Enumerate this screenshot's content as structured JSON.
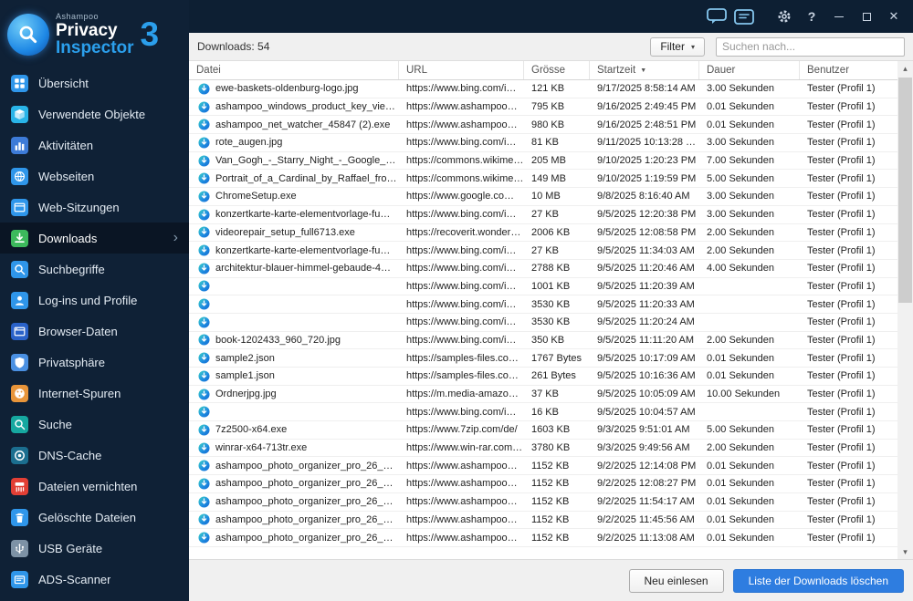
{
  "logo": {
    "brand": "Ashampoo",
    "line1": "Privacy",
    "line2": "Inspector",
    "version": "3"
  },
  "titlebar": {
    "help_label": "?"
  },
  "toolbar": {
    "count_label": "Downloads: 54",
    "filter_label": "Filter",
    "search_placeholder": "Suchen nach..."
  },
  "sidebar": {
    "items": [
      {
        "id": "uebersicht",
        "label": "Übersicht",
        "icon": "dashboard",
        "color": "#2f96ea"
      },
      {
        "id": "verwendete-objekte",
        "label": "Verwendete Objekte",
        "icon": "cube",
        "color": "#29b4e8"
      },
      {
        "id": "aktivitaeten",
        "label": "Aktivitäten",
        "icon": "chart",
        "color": "#3d7bd8"
      },
      {
        "id": "webseiten",
        "label": "Webseiten",
        "icon": "globe",
        "color": "#2f96ea"
      },
      {
        "id": "web-sitzungen",
        "label": "Web-Sitzungen",
        "icon": "sessions",
        "color": "#2f96ea"
      },
      {
        "id": "downloads",
        "label": "Downloads",
        "icon": "download",
        "color": "#3cb95c",
        "selected": true
      },
      {
        "id": "suchbegriffe",
        "label": "Suchbegriffe",
        "icon": "magnifier",
        "color": "#2f96ea"
      },
      {
        "id": "logins-und-profile",
        "label": "Log-ins und Profile",
        "icon": "user",
        "color": "#2f96ea"
      },
      {
        "id": "browser-daten",
        "label": "Browser-Daten",
        "icon": "browser",
        "color": "#2a62c9"
      },
      {
        "id": "privatsphaere",
        "label": "Privatsphäre",
        "icon": "shield",
        "color": "#4a90e2"
      },
      {
        "id": "internet-spuren",
        "label": "Internet-Spuren",
        "icon": "palette",
        "color": "#e8953a"
      },
      {
        "id": "suche",
        "label": "Suche",
        "icon": "magnifier",
        "color": "#16a8a0"
      },
      {
        "id": "dns-cache",
        "label": "DNS-Cache",
        "icon": "dns",
        "color": "#1b6e8f"
      },
      {
        "id": "dateien-vernichten",
        "label": "Dateien vernichten",
        "icon": "shred",
        "color": "#e23f35"
      },
      {
        "id": "geloeschte-dateien",
        "label": "Gelöschte Dateien",
        "icon": "trash",
        "color": "#2f96ea"
      },
      {
        "id": "usb-geraete",
        "label": "USB Geräte",
        "icon": "usb",
        "color": "#7d92a6"
      },
      {
        "id": "ads-scanner",
        "label": "ADS-Scanner",
        "icon": "scan",
        "color": "#2f96ea"
      }
    ]
  },
  "table": {
    "columns": [
      "Datei",
      "URL",
      "Grösse",
      "Startzeit",
      "Dauer",
      "Benutzer"
    ],
    "sort_column": "Startzeit",
    "rows": [
      [
        "ewe-baskets-oldenburg-logo.jpg",
        "https://www.bing.com/i…",
        "121 KB",
        "9/17/2025 8:58:14 AM",
        "3.00 Sekunden",
        "Tester (Profil 1)"
      ],
      [
        "ashampoo_windows_product_key_vie…",
        "https://www.ashampoo…",
        "795 KB",
        "9/16/2025 2:49:45 PM",
        "0.01 Sekunden",
        "Tester (Profil 1)"
      ],
      [
        "ashampoo_net_watcher_45847 (2).exe",
        "https://www.ashampoo…",
        "980 KB",
        "9/16/2025 2:48:51 PM",
        "0.01 Sekunden",
        "Tester (Profil 1)"
      ],
      [
        "rote_augen.jpg",
        "https://www.bing.com/i…",
        "81 KB",
        "9/11/2025 10:13:28 …",
        "3.00 Sekunden",
        "Tester (Profil 1)"
      ],
      [
        "Van_Gogh_-_Starry_Night_-_Google_A…",
        "https://commons.wikime…",
        "205 MB",
        "9/10/2025 1:20:23 PM",
        "7.00 Sekunden",
        "Tester (Profil 1)"
      ],
      [
        "Portrait_of_a_Cardinal_by_Raffael_fro…",
        "https://commons.wikime…",
        "149 MB",
        "9/10/2025 1:19:59 PM",
        "5.00 Sekunden",
        "Tester (Profil 1)"
      ],
      [
        "ChromeSetup.exe",
        "https://www.google.co…",
        "10 MB",
        "9/8/2025 8:16:40 AM",
        "3.00 Sekunden",
        "Tester (Profil 1)"
      ],
      [
        "konzertkarte-karte-elementvorlage-fu…",
        "https://www.bing.com/i…",
        "27 KB",
        "9/5/2025 12:20:38 PM",
        "3.00 Sekunden",
        "Tester (Profil 1)"
      ],
      [
        "videorepair_setup_full6713.exe",
        "https://recoverit.wonder…",
        "2006 KB",
        "9/5/2025 12:08:58 PM",
        "2.00 Sekunden",
        "Tester (Profil 1)"
      ],
      [
        "konzertkarte-karte-elementvorlage-fu…",
        "https://www.bing.com/i…",
        "27 KB",
        "9/5/2025 11:34:03 AM",
        "2.00 Sekunden",
        "Tester (Profil 1)"
      ],
      [
        "architektur-blauer-himmel-gebaude-4…",
        "https://www.bing.com/i…",
        "2788 KB",
        "9/5/2025 11:20:46 AM",
        "4.00 Sekunden",
        "Tester (Profil 1)"
      ],
      [
        "",
        "https://www.bing.com/i…",
        "1001 KB",
        "9/5/2025 11:20:39 AM",
        "",
        "Tester (Profil 1)"
      ],
      [
        "",
        "https://www.bing.com/i…",
        "3530 KB",
        "9/5/2025 11:20:33 AM",
        "",
        "Tester (Profil 1)"
      ],
      [
        "",
        "https://www.bing.com/i…",
        "3530 KB",
        "9/5/2025 11:20:24 AM",
        "",
        "Tester (Profil 1)"
      ],
      [
        "book-1202433_960_720.jpg",
        "https://www.bing.com/i…",
        "350 KB",
        "9/5/2025 11:11:20 AM",
        "2.00 Sekunden",
        "Tester (Profil 1)"
      ],
      [
        "sample2.json",
        "https://samples-files.co…",
        "1767 Bytes",
        "9/5/2025 10:17:09 AM",
        "0.01 Sekunden",
        "Tester (Profil 1)"
      ],
      [
        "sample1.json",
        "https://samples-files.co…",
        "261 Bytes",
        "9/5/2025 10:16:36 AM",
        "0.01 Sekunden",
        "Tester (Profil 1)"
      ],
      [
        "Ordnerjpg.jpg",
        "https://m.media-amazo…",
        "37 KB",
        "9/5/2025 10:05:09 AM",
        "10.00 Sekunden",
        "Tester (Profil 1)"
      ],
      [
        "",
        "https://www.bing.com/i…",
        "16 KB",
        "9/5/2025 10:04:57 AM",
        "",
        "Tester (Profil 1)"
      ],
      [
        "7z2500-x64.exe",
        "https://www.7zip.com/de/",
        "1603 KB",
        "9/3/2025 9:51:01 AM",
        "5.00 Sekunden",
        "Tester (Profil 1)"
      ],
      [
        "winrar-x64-713tr.exe",
        "https://www.win-rar.com…",
        "3780 KB",
        "9/3/2025 9:49:56 AM",
        "2.00 Sekunden",
        "Tester (Profil 1)"
      ],
      [
        "ashampoo_photo_organizer_pro_26_…",
        "https://www.ashampoo…",
        "1152 KB",
        "9/2/2025 12:14:08 PM",
        "0.01 Sekunden",
        "Tester (Profil 1)"
      ],
      [
        "ashampoo_photo_organizer_pro_26_…",
        "https://www.ashampoo…",
        "1152 KB",
        "9/2/2025 12:08:27 PM",
        "0.01 Sekunden",
        "Tester (Profil 1)"
      ],
      [
        "ashampoo_photo_organizer_pro_26_…",
        "https://www.ashampoo…",
        "1152 KB",
        "9/2/2025 11:54:17 AM",
        "0.01 Sekunden",
        "Tester (Profil 1)"
      ],
      [
        "ashampoo_photo_organizer_pro_26_…",
        "https://www.ashampoo…",
        "1152 KB",
        "9/2/2025 11:45:56 AM",
        "0.01 Sekunden",
        "Tester (Profil 1)"
      ],
      [
        "ashampoo_photo_organizer_pro_26_…",
        "https://www.ashampoo…",
        "1152 KB",
        "9/2/2025 11:13:08 AM",
        "0.01 Sekunden",
        "Tester (Profil 1)"
      ]
    ]
  },
  "footer": {
    "reload_label": "Neu einlesen",
    "clear_label": "Liste der Downloads löschen"
  },
  "colors": {
    "accent": "#2e7de0",
    "sidebar_bg": "#0f2136",
    "selected_bg": "#0a1524",
    "file_icon_gradient": [
      "#3fd4c5",
      "#1f8fe0",
      "#1467d2"
    ]
  }
}
